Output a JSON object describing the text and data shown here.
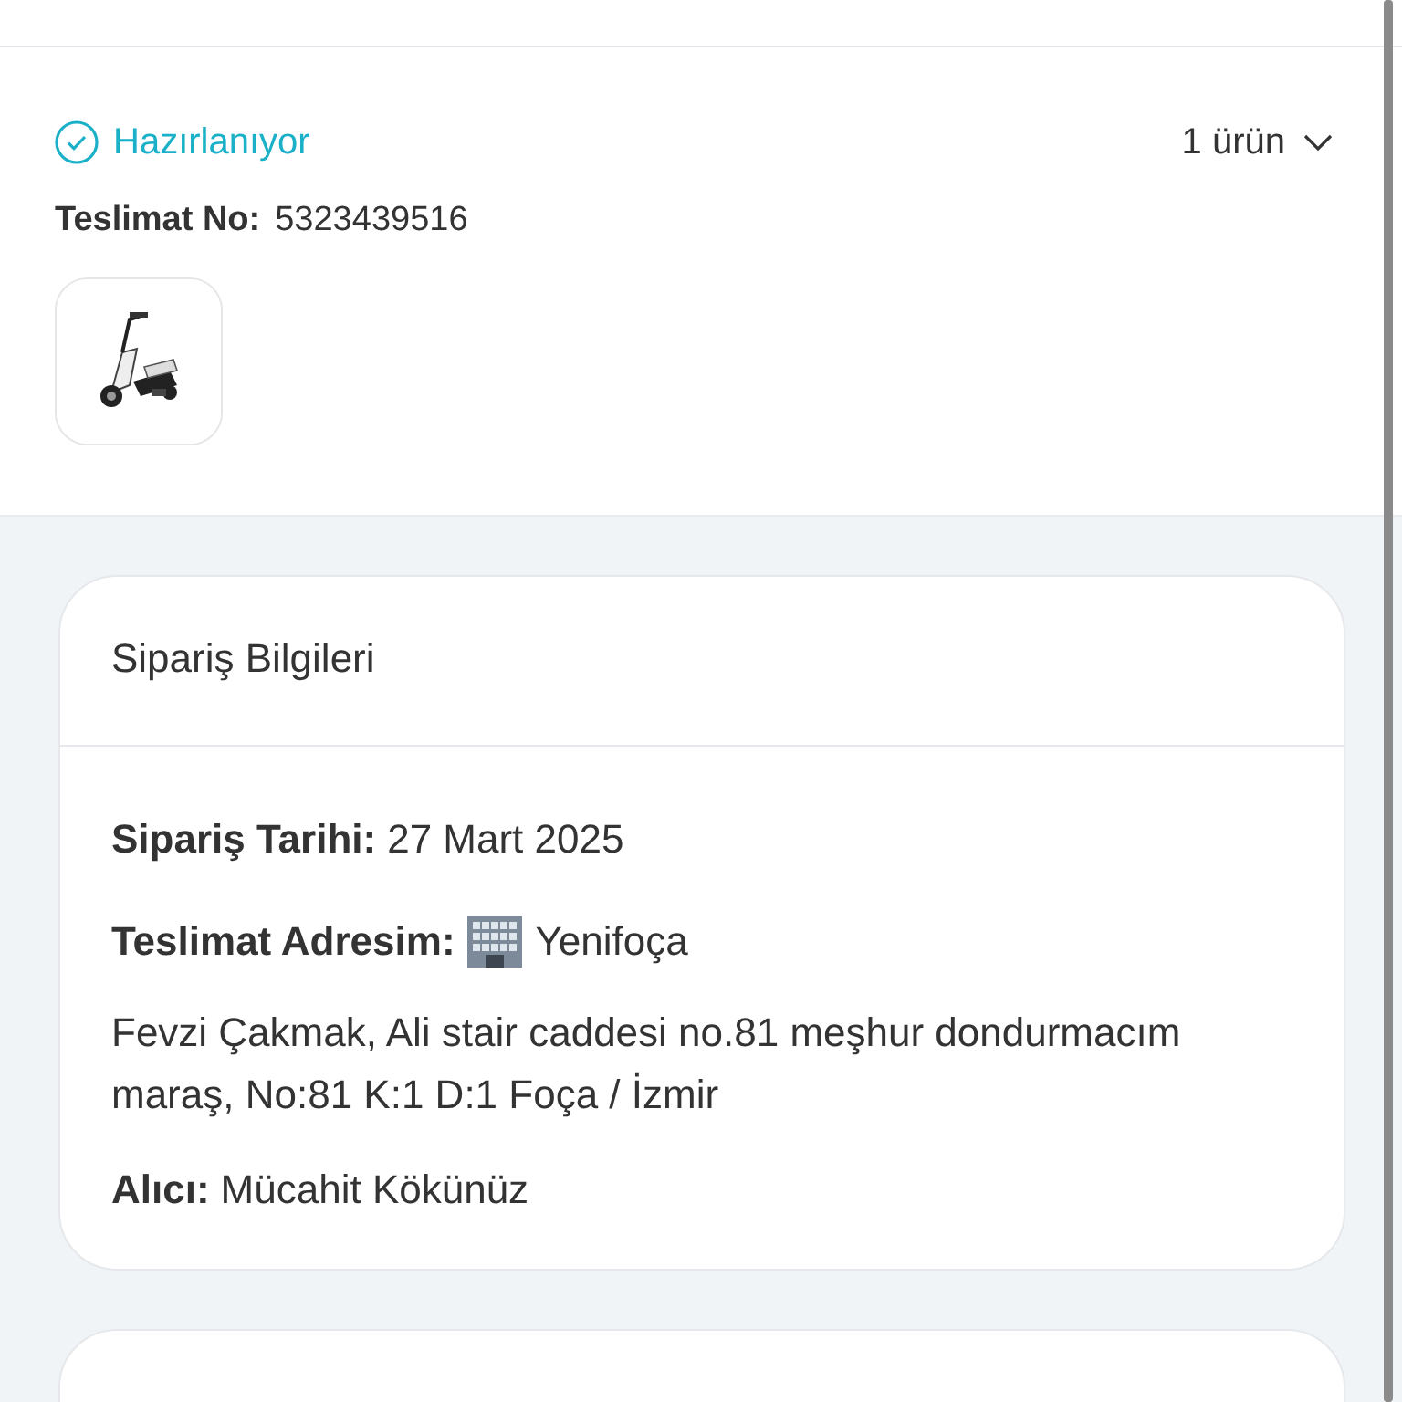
{
  "shipment": {
    "status": {
      "label": "Hazırlanıyor",
      "color": "#1ab0c8"
    },
    "item_count": "1 ürün",
    "expanded": false,
    "delivery_no": {
      "label": "Teslimat No:",
      "value": "5323439516"
    }
  },
  "order_info": {
    "title": "Sipariş Bilgileri",
    "fields": [
      {
        "kind": "plain",
        "label": "Sipariş Tarihi:",
        "value": "27 Mart 2025"
      },
      {
        "kind": "place",
        "label": "Teslimat Adresim:",
        "value": "Yenifoça"
      },
      {
        "kind": "paragraph",
        "value": "Fevzi Çakmak, Ali stair caddesi no.81 meşhur dondurmacım maraş, No:81 K:1 D:1 Foça / İzmir"
      },
      {
        "kind": "plain",
        "label": "Alıcı:",
        "value": "Mücahit Kökünüz"
      }
    ]
  }
}
